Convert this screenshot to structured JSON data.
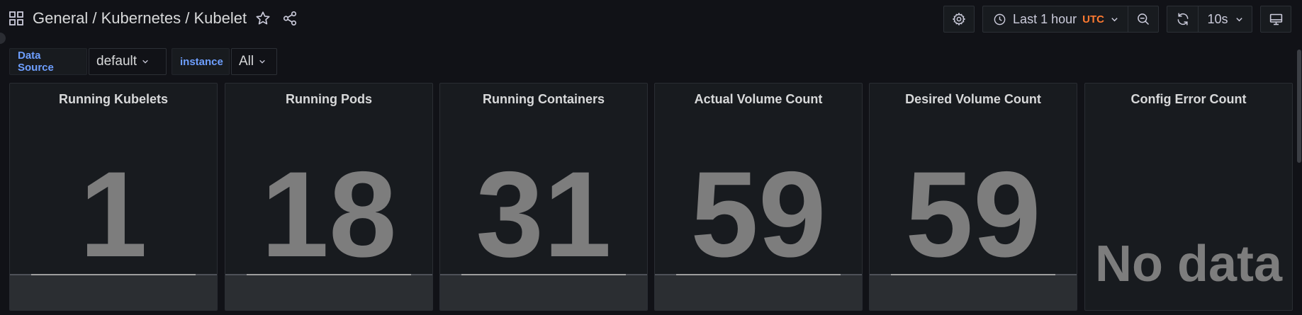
{
  "breadcrumb": {
    "folder": "General",
    "separator": " / ",
    "parent": "Kubernetes",
    "title": "Kubelet"
  },
  "toolbar": {
    "time_range": "Last 1 hour",
    "timezone": "UTC",
    "refresh_interval": "10s"
  },
  "variables": [
    {
      "label": "Data Source",
      "value": "default"
    },
    {
      "label": "instance",
      "value": "All"
    }
  ],
  "panels": [
    {
      "title": "Running Kubelets",
      "value": "1"
    },
    {
      "title": "Running Pods",
      "value": "18"
    },
    {
      "title": "Running Containers",
      "value": "31"
    },
    {
      "title": "Actual Volume Count",
      "value": "59"
    },
    {
      "title": "Desired Volume Count",
      "value": "59"
    },
    {
      "title": "Config Error Count",
      "value": "No data"
    }
  ],
  "colors": {
    "background": "#111217",
    "panel": "#181b1f",
    "value_gray": "#7d7d7d",
    "utc_orange": "#ff7a31",
    "variable_blue": "#6e9fff"
  },
  "icons": [
    "apps-icon",
    "star-icon",
    "share-icon",
    "gear-icon",
    "clock-icon",
    "chevron-down-icon",
    "zoom-out-icon",
    "refresh-icon",
    "tv-icon"
  ]
}
